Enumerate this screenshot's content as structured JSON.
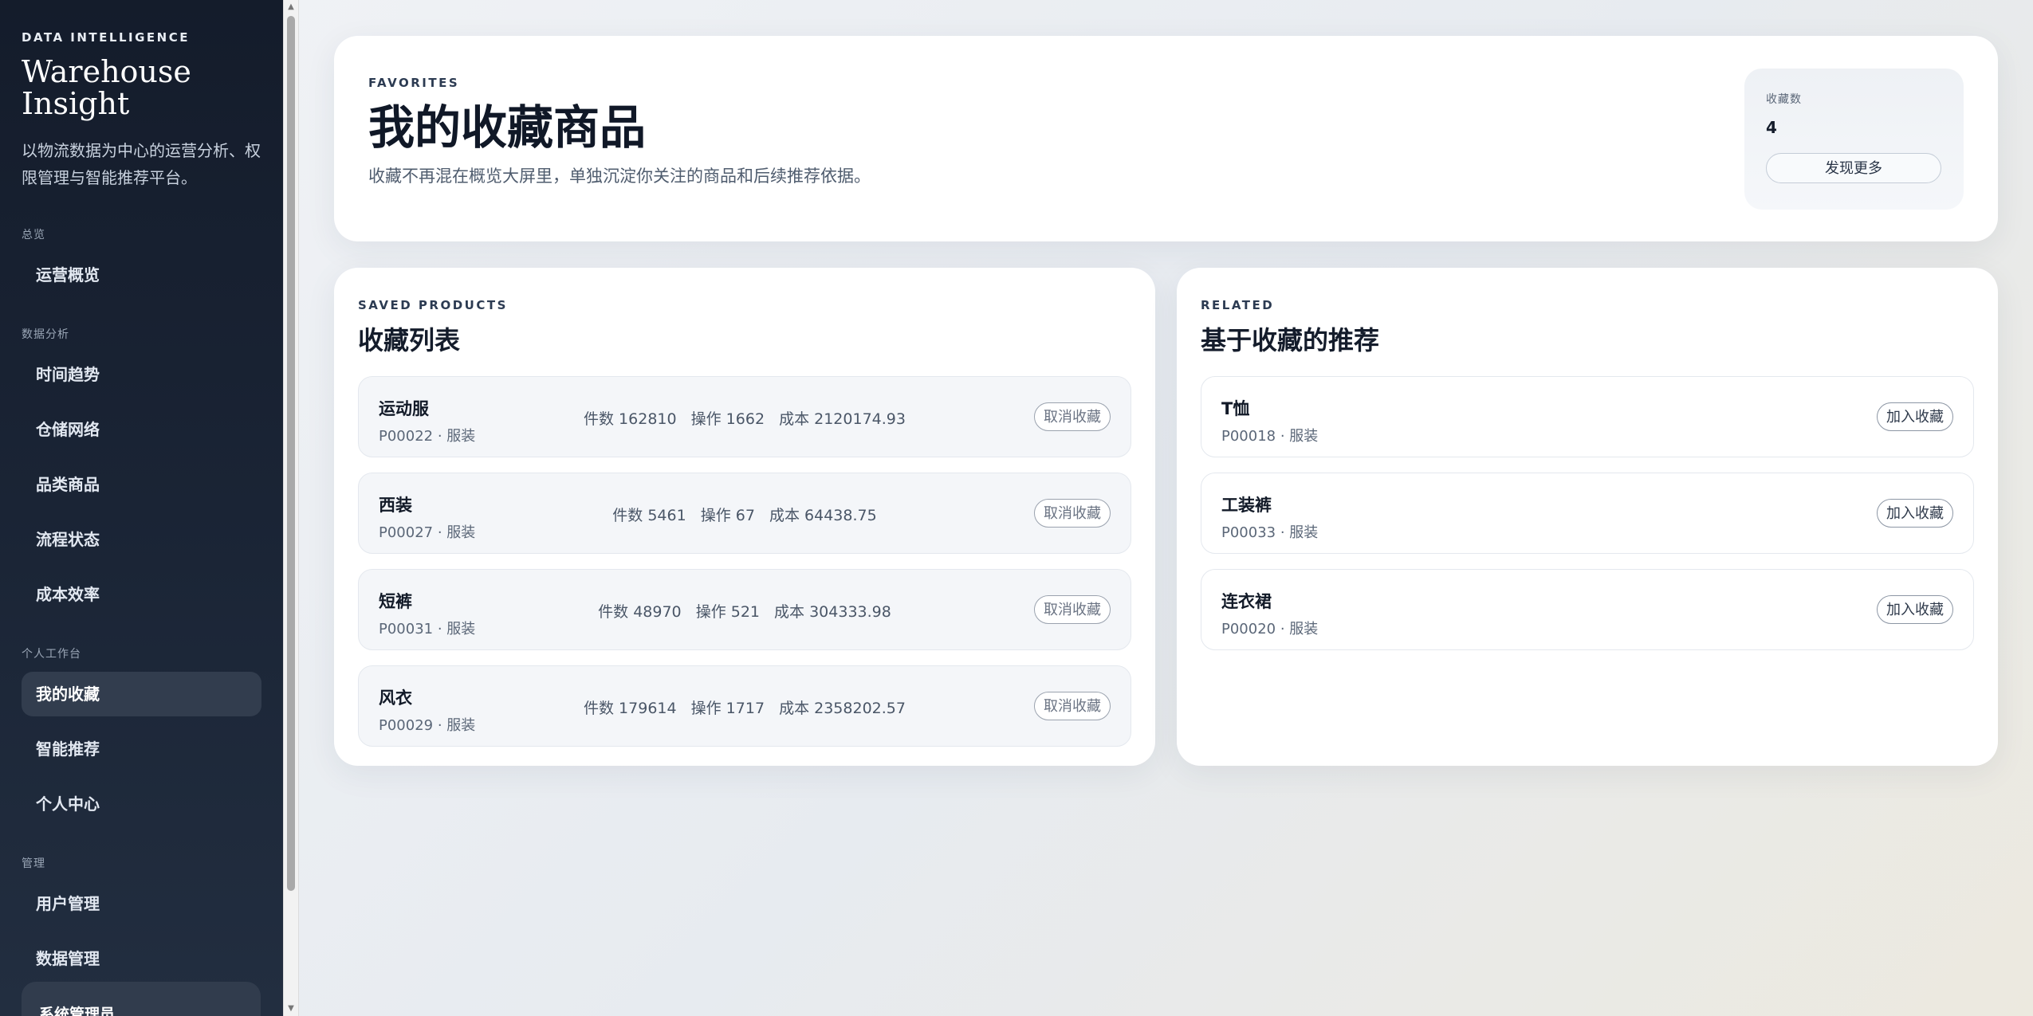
{
  "sidebar": {
    "eyebrow": "DATA INTELLIGENCE",
    "title_line1": "Warehouse",
    "title_line2": "Insight",
    "description": "以物流数据为中心的运营分析、权限管理与智能推荐平台。",
    "groups": [
      {
        "label": "总览",
        "items": [
          {
            "label": "运营概览"
          }
        ]
      },
      {
        "label": "数据分析",
        "items": [
          {
            "label": "时间趋势"
          },
          {
            "label": "仓储网络"
          },
          {
            "label": "品类商品"
          },
          {
            "label": "流程状态"
          },
          {
            "label": "成本效率"
          }
        ]
      },
      {
        "label": "个人工作台",
        "items": [
          {
            "label": "我的收藏",
            "active": true
          },
          {
            "label": "智能推荐"
          },
          {
            "label": "个人中心"
          }
        ]
      },
      {
        "label": "管理",
        "items": [
          {
            "label": "用户管理"
          },
          {
            "label": "数据管理"
          }
        ]
      }
    ],
    "user_label": "系统管理员"
  },
  "hero": {
    "eyebrow": "FAVORITES",
    "title": "我的收藏商品",
    "subtitle": "收藏不再混在概览大屏里，单独沉淀你关注的商品和后续推荐依据。",
    "stat_label": "收藏数",
    "stat_value": "4",
    "stat_button": "发现更多"
  },
  "saved": {
    "eyebrow": "SAVED PRODUCTS",
    "title": "收藏列表",
    "button_label": "取消收藏",
    "items": [
      {
        "name": "运动服",
        "meta": "P00022 · 服装",
        "qty": "件数 162810",
        "ops": "操作 1662",
        "cost": "成本 2120174.93"
      },
      {
        "name": "西装",
        "meta": "P00027 · 服装",
        "qty": "件数 5461",
        "ops": "操作 67",
        "cost": "成本 64438.75"
      },
      {
        "name": "短裤",
        "meta": "P00031 · 服装",
        "qty": "件数 48970",
        "ops": "操作 521",
        "cost": "成本 304333.98"
      },
      {
        "name": "风衣",
        "meta": "P00029 · 服装",
        "qty": "件数 179614",
        "ops": "操作 1717",
        "cost": "成本 2358202.57"
      }
    ]
  },
  "related": {
    "eyebrow": "RELATED",
    "title": "基于收藏的推荐",
    "button_label": "加入收藏",
    "items": [
      {
        "name": "T恤",
        "meta": "P00018 · 服装"
      },
      {
        "name": "工装裤",
        "meta": "P00033 · 服装"
      },
      {
        "name": "连衣裙",
        "meta": "P00020 · 服装"
      }
    ]
  },
  "colors": {
    "sidebar_bg": "#1a2435",
    "active_item_bg": "#323d4e",
    "page_bg": "#e7ebf0",
    "card_bg": "#ffffff"
  }
}
